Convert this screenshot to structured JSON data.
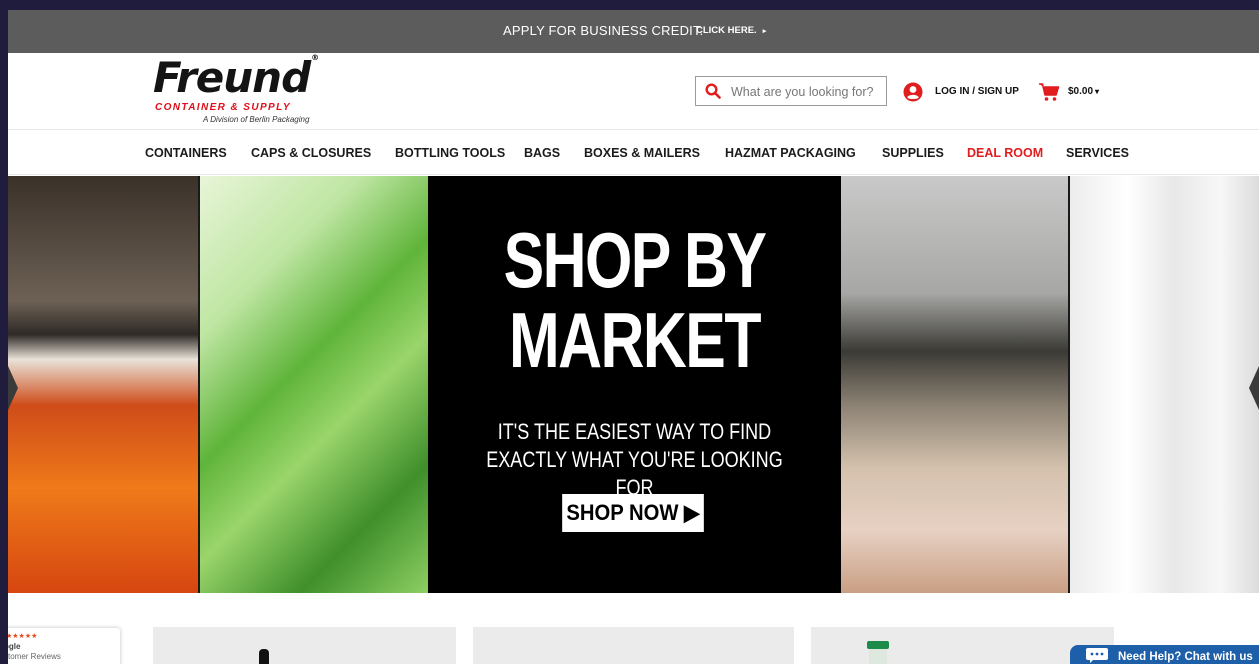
{
  "topbar": {
    "promo": "APPLY FOR BUSINESS CREDIT.",
    "cta": "CLICK HERE.",
    "cta_arrow": "▸"
  },
  "header": {
    "logo": {
      "brand": "Freund",
      "reg": "®",
      "subtitle": "CONTAINER & SUPPLY",
      "division": "A Division of Berlin Packaging"
    },
    "search": {
      "placeholder": "What are you looking for?",
      "icon": "search-icon"
    },
    "account": {
      "label": "LOG IN / SIGN UP",
      "icon": "user-circle-icon"
    },
    "cart": {
      "total": "$0.00",
      "caret": "▾",
      "icon": "cart-icon"
    }
  },
  "nav": [
    {
      "label": "CONTAINERS"
    },
    {
      "label": "CAPS & CLOSURES"
    },
    {
      "label": "BOTTLING TOOLS"
    },
    {
      "label": "BAGS"
    },
    {
      "label": "BOXES & MAILERS"
    },
    {
      "label": "HAZMAT PACKAGING"
    },
    {
      "label": "SUPPLIES"
    },
    {
      "label": "DEAL ROOM",
      "color": "#e21d1d"
    },
    {
      "label": "SERVICES"
    }
  ],
  "hero": {
    "headline_line1": "SHOP BY",
    "headline_line2": "MARKET",
    "tagline_line1": "IT'S THE EASIEST WAY TO FIND",
    "tagline_line2": "EXACTLY WHAT YOU'RE LOOKING FOR",
    "button": "SHOP NOW ▶"
  },
  "reviews_badge": {
    "stars": "★★★★★",
    "line1": "ogle",
    "line2": "stomer Reviews"
  },
  "chat": {
    "label": "Need Help? Chat with us",
    "icon": "chat-bubble-icon"
  },
  "colors": {
    "accent_red": "#e21d1d",
    "topbar": "#5c5c5c",
    "chat_blue": "#1d5fa8"
  }
}
